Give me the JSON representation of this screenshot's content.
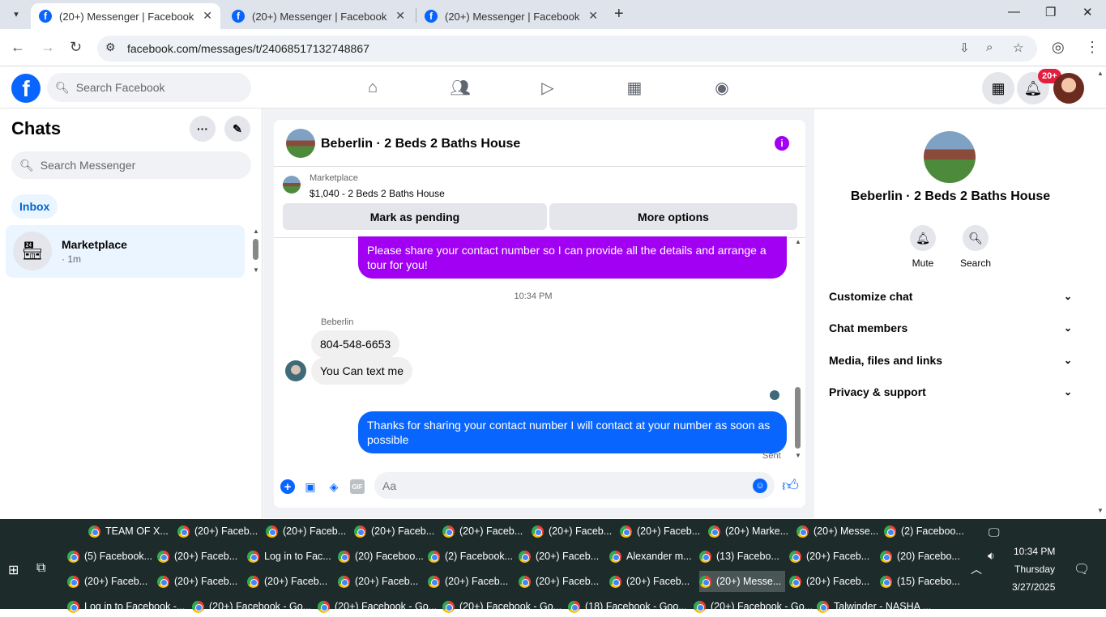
{
  "browser": {
    "tabs": [
      {
        "title": "(20+) Messenger | Facebook",
        "active": true
      },
      {
        "title": "(20+) Messenger | Facebook",
        "active": false
      },
      {
        "title": "(20+) Messenger | Facebook",
        "active": false
      }
    ],
    "url": "facebook.com/messages/t/24068517132748867"
  },
  "fb_header": {
    "search_placeholder": "Search Facebook",
    "notifications_badge": "20+"
  },
  "sidebar": {
    "title": "Chats",
    "search_placeholder": "Search Messenger",
    "filter_label": "Inbox",
    "chats": [
      {
        "name": "Marketplace",
        "meta": "· 1m"
      }
    ]
  },
  "conversation": {
    "title": "Beberlin · 2 Beds 2 Baths House",
    "marketplace_label": "Marketplace",
    "listing": "$1,040 - 2 Beds 2 Baths House",
    "mark_pending_label": "Mark as pending",
    "more_options_label": "More options",
    "messages": [
      {
        "from": "me",
        "text": "Please share your contact number so I can provide all the details and arrange a tour for you!"
      },
      {
        "type": "time",
        "text": "10:34 PM"
      },
      {
        "from": "them",
        "sender": "Beberlin",
        "text": "804-548-6653"
      },
      {
        "from": "them",
        "text": "You Can text me"
      },
      {
        "from": "me",
        "text": "Thanks for sharing your contact number I will contact at your number as soon as possible"
      }
    ],
    "status": "Sent",
    "composer_placeholder": "Aa",
    "gif_label": "GIF"
  },
  "details": {
    "title": "Beberlin · 2 Beds 2 Baths House",
    "actions": [
      {
        "label": "Mute",
        "icon": "bell-icon"
      },
      {
        "label": "Search",
        "icon": "search-icon"
      }
    ],
    "sections": [
      {
        "label": "Customize chat"
      },
      {
        "label": "Chat members"
      },
      {
        "label": "Media, files and links"
      },
      {
        "label": "Privacy & support"
      }
    ]
  },
  "taskbar": {
    "rows": [
      [
        "TEAM OF X...",
        "(20+) Faceb...",
        "(20+) Faceb...",
        "(20+) Faceb...",
        "(20+) Faceb...",
        "(20+) Faceb...",
        "(20+) Faceb...",
        "(20+) Marke...",
        "(20+) Messe...",
        "(2) Faceboo..."
      ],
      [
        "(5) Facebook...",
        "(20+) Faceb...",
        "Log in to Fac...",
        "(20) Faceboo...",
        "(2) Facebook...",
        "(20+) Faceb...",
        "Alexander m...",
        "(13) Facebo...",
        "(20+) Faceb...",
        "(20) Facebo..."
      ],
      [
        "(20+) Faceb...",
        "(20+) Faceb...",
        "(20+) Faceb...",
        "(20+) Faceb...",
        "(20+) Faceb...",
        "(20+) Faceb...",
        "(20+) Faceb...",
        "(20+) Messe...",
        "(20+) Faceb...",
        "(15) Facebo..."
      ],
      [
        "Log in to Facebook -...",
        "(20+) Facebook - Go...",
        "(20+) Facebook - Go...",
        "(20+) Facebook - Go...",
        "(18) Facebook - Goo...",
        "(20+) Facebook - Go...",
        "Talwinder - NASHA ..."
      ]
    ],
    "clock_time": "10:34 PM",
    "clock_day": "Thursday",
    "clock_date": "3/27/2025"
  }
}
